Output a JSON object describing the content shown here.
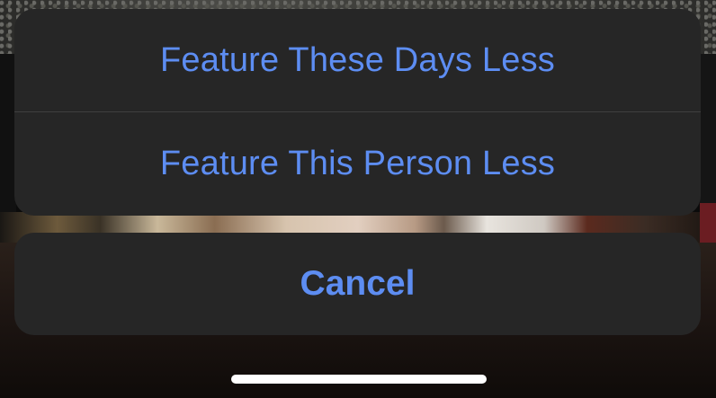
{
  "action_sheet": {
    "actions": [
      {
        "label": "Feature These Days Less"
      },
      {
        "label": "Feature This Person Less"
      }
    ],
    "cancel_label": "Cancel"
  },
  "colors": {
    "action_text": "#5d8df2",
    "sheet_background": "#262626"
  }
}
